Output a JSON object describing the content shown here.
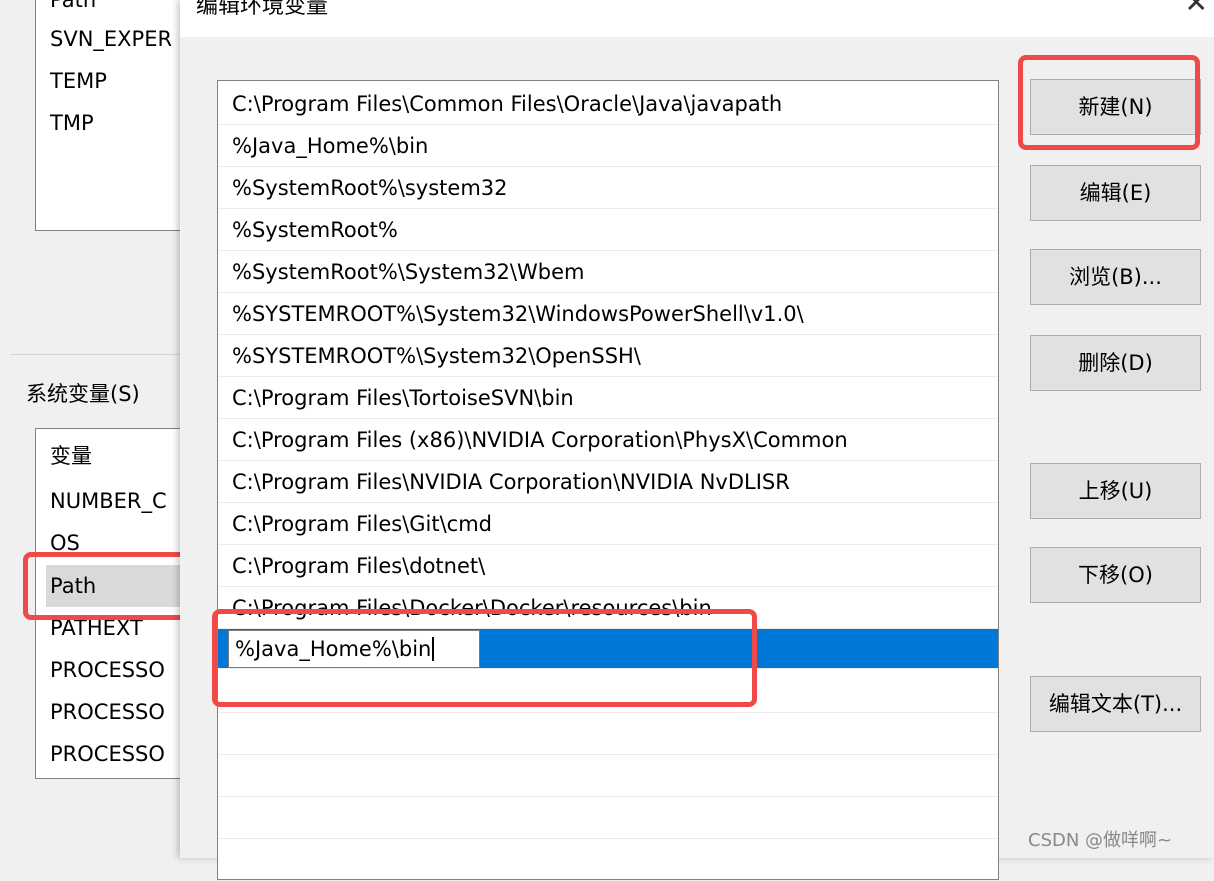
{
  "user_vars": {
    "items": [
      "Path",
      "SVN_EXPER",
      "TEMP",
      "TMP"
    ]
  },
  "system_vars": {
    "group_label": "系统变量(S)",
    "items": [
      "变量",
      "NUMBER_C",
      "OS",
      "Path",
      "PATHEXT",
      "PROCESSO",
      "PROCESSO",
      "PROCESSO"
    ],
    "selected": "Path"
  },
  "dialog": {
    "title": "编辑环境变量",
    "entries": [
      "C:\\Program Files\\Common Files\\Oracle\\Java\\javapath",
      "%Java_Home%\\bin",
      "%SystemRoot%\\system32",
      "%SystemRoot%",
      "%SystemRoot%\\System32\\Wbem",
      "%SYSTEMROOT%\\System32\\WindowsPowerShell\\v1.0\\",
      "%SYSTEMROOT%\\System32\\OpenSSH\\",
      "C:\\Program Files\\TortoiseSVN\\bin",
      "C:\\Program Files (x86)\\NVIDIA Corporation\\PhysX\\Common",
      "C:\\Program Files\\NVIDIA Corporation\\NVIDIA NvDLISR",
      "C:\\Program Files\\Git\\cmd",
      "C:\\Program Files\\dotnet\\",
      "C:\\Program Files\\Docker\\Docker\\resources\\bin"
    ],
    "edit_value": "%Java_Home%\\bin",
    "buttons": {
      "new": "新建(N)",
      "edit": "编辑(E)",
      "browse": "浏览(B)...",
      "delete": "删除(D)",
      "up": "上移(U)",
      "down": "下移(O)",
      "edit_text": "编辑文本(T)..."
    }
  },
  "watermark": "CSDN @做咩啊~",
  "colors": {
    "selection": "#0078d7",
    "highlight": "#f04a48"
  }
}
